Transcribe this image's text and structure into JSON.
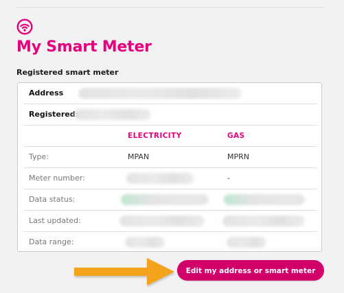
{
  "header": {
    "icon": "wifi-signal-icon",
    "title": "My Smart Meter",
    "accent_color": "#e6007e"
  },
  "section": {
    "label": "Registered smart meter"
  },
  "card": {
    "address_label": "Address",
    "registered_label": "Registered:",
    "columns": {
      "electricity": "ELECTRICITY",
      "gas": "GAS"
    },
    "rows": [
      {
        "label": "Type:",
        "electricity": "MPAN",
        "gas": "MPRN"
      },
      {
        "label": "Meter number:",
        "electricity": "",
        "gas": "-"
      },
      {
        "label": "Data status:",
        "electricity": "",
        "gas": ""
      },
      {
        "label": "Last updated:",
        "electricity": "",
        "gas": ""
      },
      {
        "label": "Data range:",
        "electricity": "",
        "gas": ""
      }
    ]
  },
  "actions": {
    "edit_button_label": "Edit my address or smart meter",
    "button_color": "#d1006b",
    "arrow_color": "#f5a21b"
  }
}
